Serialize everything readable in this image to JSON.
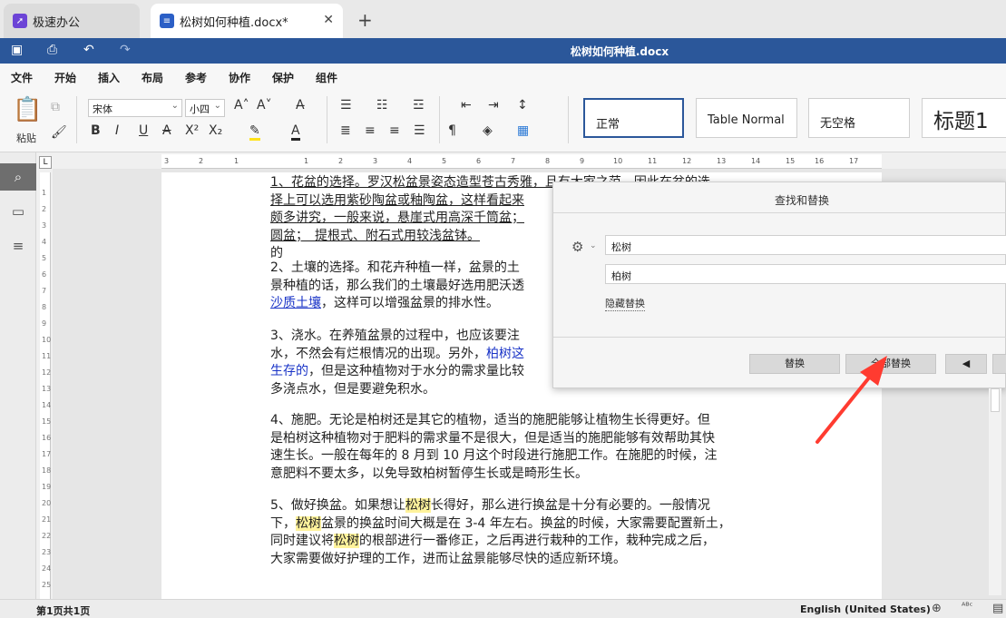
{
  "tabs": [
    {
      "label": "极速办公",
      "icon": "rocket-icon"
    },
    {
      "label": "松树如何种植.docx*",
      "icon": "document-icon"
    }
  ],
  "new_tab": "+",
  "title": "松树如何种植.docx",
  "menu": [
    "文件",
    "开始",
    "插入",
    "布局",
    "参考",
    "协作",
    "保护",
    "组件"
  ],
  "ribbon": {
    "paste_label": "粘贴",
    "font": "宋体",
    "size": "小四",
    "styles": [
      "正常",
      "Table Normal",
      "无空格",
      "标题1"
    ]
  },
  "ruler_h": [
    "3",
    "2",
    "1",
    "1",
    "2",
    "3",
    "4",
    "5",
    "6",
    "7",
    "8",
    "9",
    "10",
    "11",
    "12",
    "13",
    "14",
    "15",
    "16",
    "17"
  ],
  "ruler_v": [
    "1",
    "2",
    "3",
    "4",
    "5",
    "6",
    "7",
    "8",
    "9",
    "10",
    "11",
    "12",
    "13",
    "14",
    "15",
    "16",
    "17",
    "18",
    "19",
    "20",
    "21",
    "22",
    "23",
    "24",
    "25"
  ],
  "doc": {
    "p1": [
      "1、花盆的选择。罗汉松盆景姿态造型苍古秀雅，且有大家之范，因此在盆的选",
      "择上可以选用紫砂陶盆或釉陶盆，这样看起来",
      "颇多讲究，一般来说，悬崖式用高深千筒盆；",
      "圆盆；　提根式、附石式用较浅盆钵。"
    ],
    "p1_tail": "的",
    "p2": [
      "2、土壤的选择。和花卉种植一样，盆景的土",
      "景种植的话，那么我们的土壤最好选用肥沃透"
    ],
    "p2_blue": "沙质土壤",
    "p2_end": "，这样可以增强盆景的排水性。",
    "p3_l1": "3、浇水。在养殖盆景的过程中，也应该要注",
    "p3_l2a": "水，不然会有烂根情况的出现。另外，",
    "p3_l2b": "柏树这",
    "p3_l3a": "生存的",
    "p3_l3b": "，但是这种植物对于水分的需求量比较",
    "p3_l4": "多浇点水，但是要避免积水。",
    "p4": [
      "4、施肥。无论是柏树还是其它的植物，适当的施肥能够让植物生长得更好。但",
      "是柏树这种植物对于肥料的需求量不是很大，但是适当的施肥能够有效帮助其快",
      "速生长。一般在每年的 8 月到 10 月这个时段进行施肥工作。在施肥的时候，注",
      "意肥料不要太多，以免导致柏树暂停生长或是畸形生长。"
    ],
    "p5_l1a": "5、做好换盆。如果想让",
    "p5_hl": "松树",
    "p5_l1b": "长得好，那么进行换盆是十分有必要的。一般情况",
    "p5_l2a": "下，",
    "p5_l2b": "盆景的换盆时间大概是在 3-4 年左右。换盆的时候，大家需要配置新土，",
    "p5_l3a": "同时建议将",
    "p5_l3b": "的根部进行一番修正，之后再进行栽种的工作，栽种完成之后，",
    "p5_l4": "大家需要做好护理的工作，进而让盆景能够尽快的适应新环境。"
  },
  "dialog": {
    "title": "查找和替换",
    "find": "松树",
    "replace": "柏树",
    "hide_replace": "隐藏替换",
    "btn_replace": "替换",
    "btn_replace_all": "全部替换",
    "btn_prev": "◀"
  },
  "status": {
    "page": "第1页共1页",
    "lang": "English (United States)"
  }
}
